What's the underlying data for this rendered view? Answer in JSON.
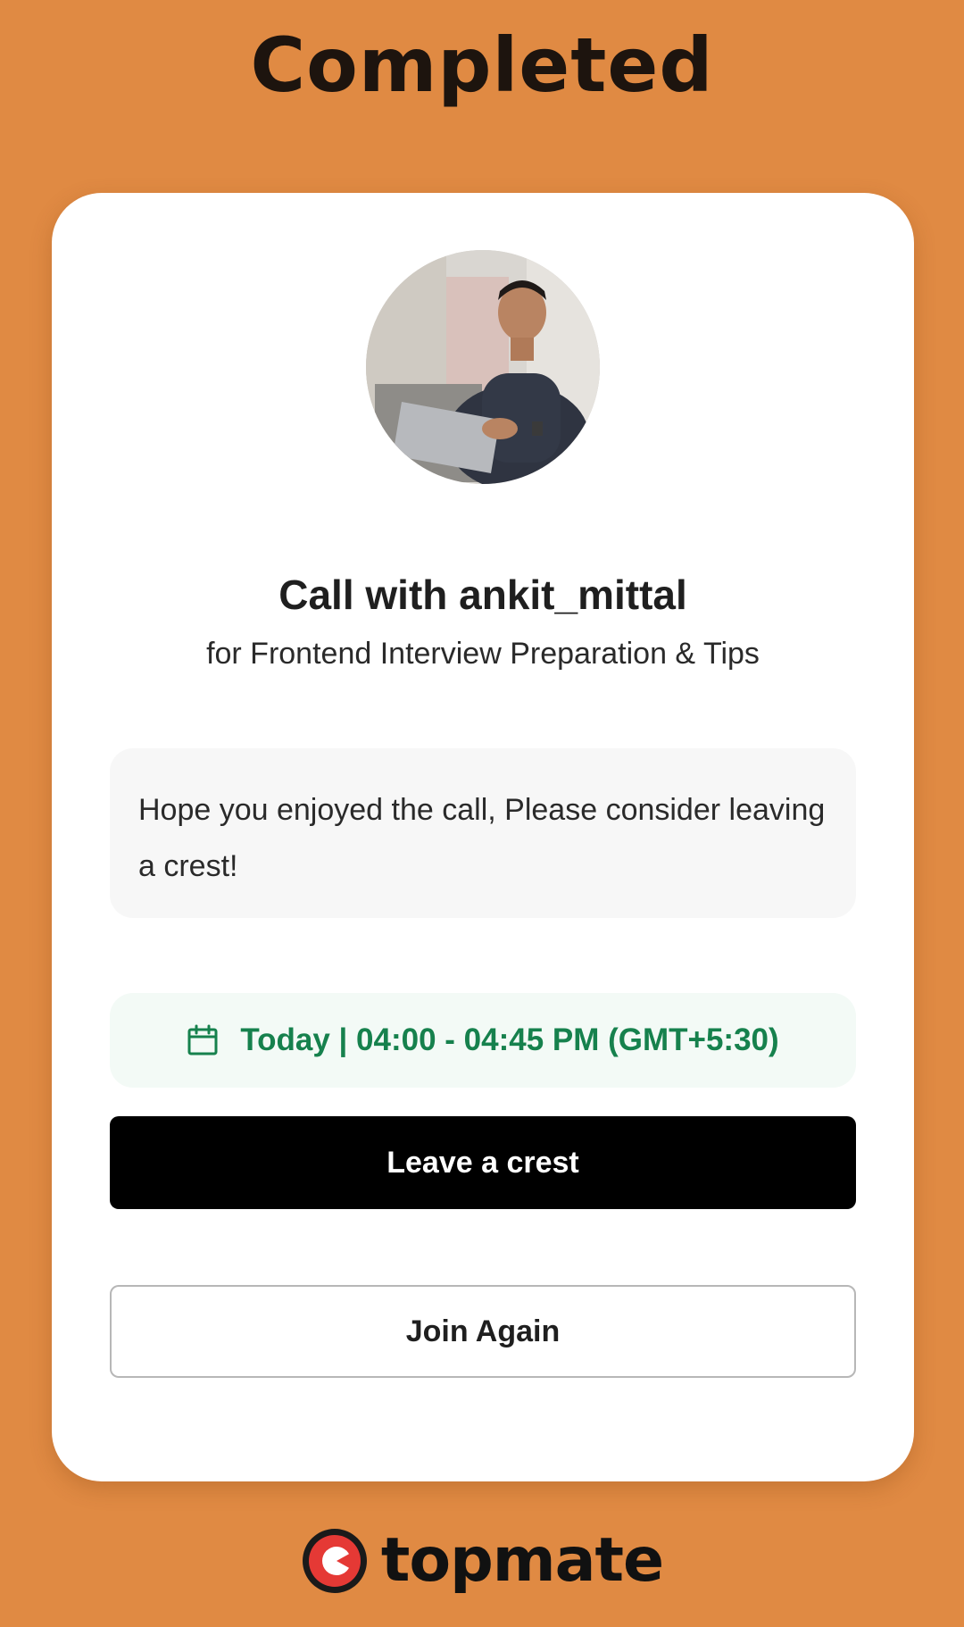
{
  "header": {
    "title": "Completed"
  },
  "call": {
    "title": "Call with ankit_mittal",
    "subtitle": "for Frontend Interview Preparation & Tips",
    "message": "Hope you enjoyed the call, Please consider leaving a crest!",
    "schedule": "Today | 04:00 - 04:45 PM (GMT+5:30)"
  },
  "actions": {
    "primary_label": "Leave a crest",
    "secondary_label": "Join Again"
  },
  "brand": {
    "name": "topmate"
  },
  "colors": {
    "background": "#e08a43",
    "card": "#ffffff",
    "schedule_text": "#16814d",
    "primary_button": "#000000",
    "brand_red": "#e53935"
  },
  "icons": {
    "schedule": "calendar-icon",
    "brand": "topmate-logo-icon"
  }
}
